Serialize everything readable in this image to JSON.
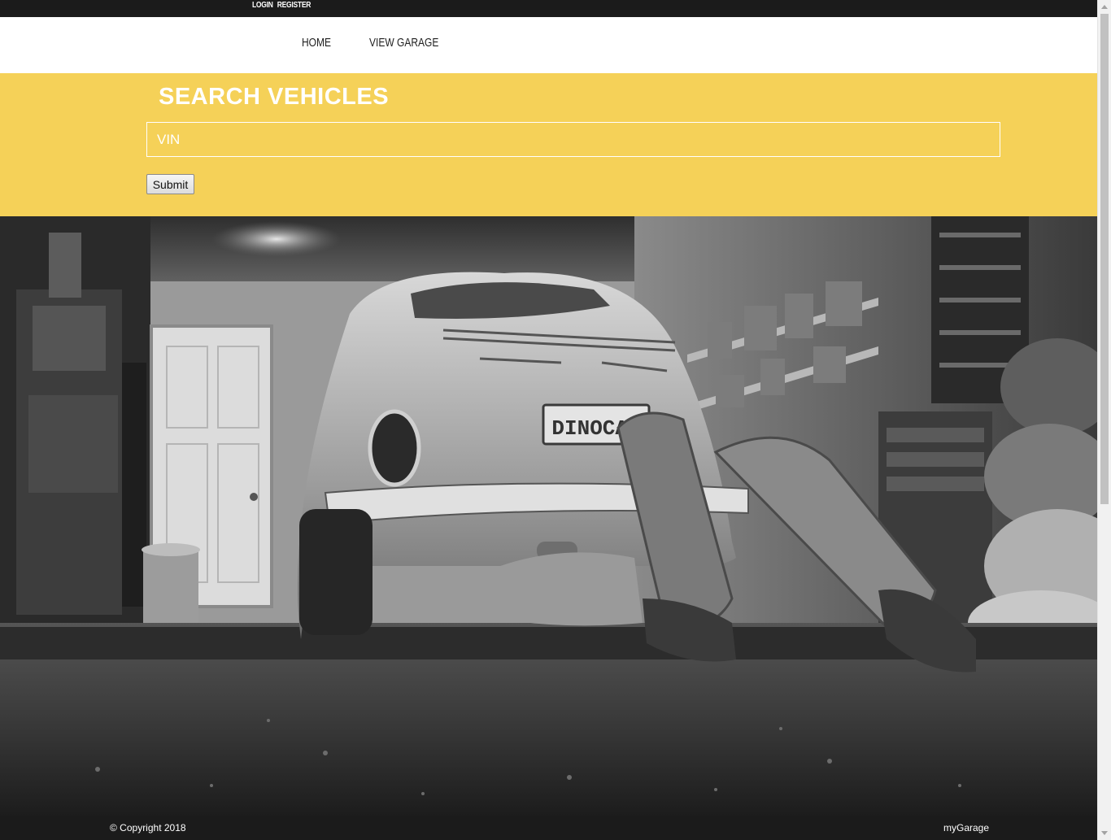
{
  "topbar": {
    "login_label": "LOGIN",
    "register_label": "REGISTER"
  },
  "nav": {
    "home_label": "HOME",
    "view_garage_label": "VIEW GARAGE"
  },
  "search": {
    "title": "SEARCH VEHICLES",
    "vin_placeholder": "VIN",
    "submit_label": "Submit"
  },
  "hero": {
    "license_plate_text": "DINOCAR"
  },
  "footer": {
    "copyright": "© Copyright 2018",
    "brand": "myGarage"
  },
  "colors": {
    "accent_yellow": "#f5d158",
    "dark_bar": "#1b1b1b",
    "nav_background": "#ffffff"
  }
}
